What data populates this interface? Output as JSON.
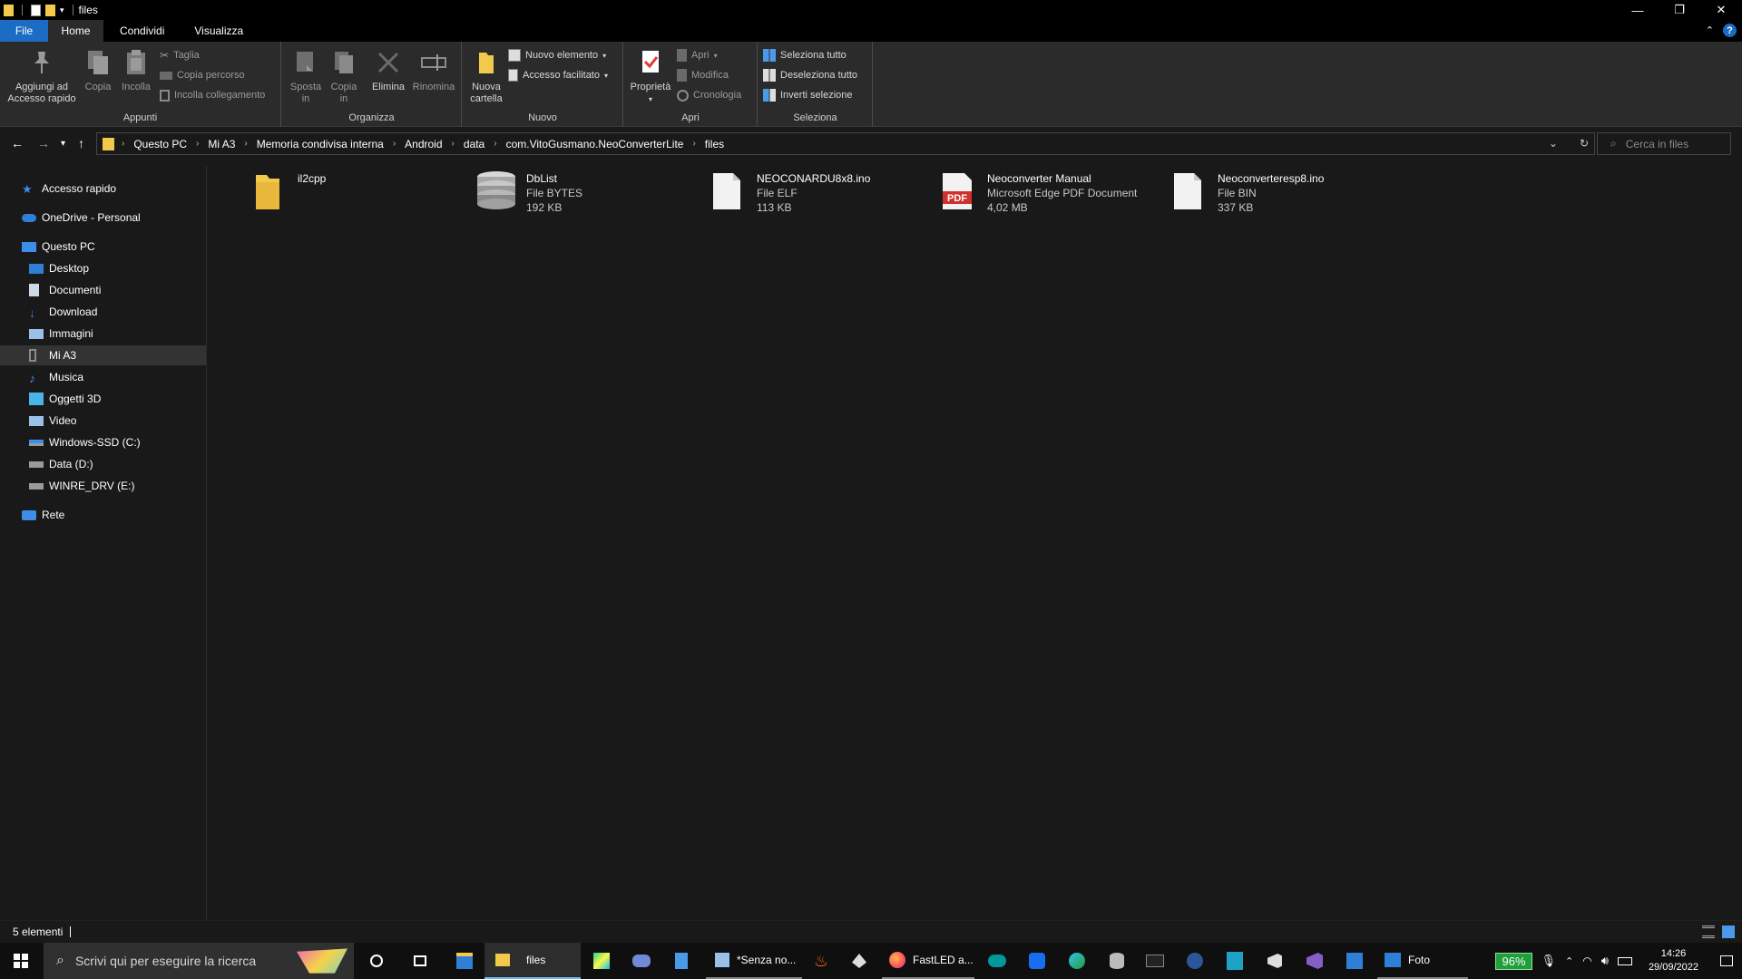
{
  "window": {
    "title": "files",
    "controls": {
      "minimize": "—",
      "maximize": "❐",
      "close": "✕"
    }
  },
  "ribbon_tabs": [
    {
      "label": "File"
    },
    {
      "label": "Home"
    },
    {
      "label": "Condividi"
    },
    {
      "label": "Visualizza"
    }
  ],
  "ribbon": {
    "appunti": {
      "label": "Appunti",
      "pin": "Aggiungi ad Accesso rapido",
      "copy": "Copia",
      "paste": "Incolla",
      "cut": "Taglia",
      "copy_path": "Copia percorso",
      "paste_link": "Incolla collegamento"
    },
    "organizza": {
      "label": "Organizza",
      "move": "Sposta in",
      "copyto": "Copia in",
      "delete": "Elimina",
      "rename": "Rinomina"
    },
    "nuovo": {
      "label": "Nuovo",
      "new_folder": "Nuova cartella",
      "new_item": "Nuovo elemento",
      "easy_access": "Accesso facilitato"
    },
    "apri": {
      "label": "Apri",
      "properties": "Proprietà",
      "open": "Apri",
      "edit": "Modifica",
      "history": "Cronologia"
    },
    "seleziona": {
      "label": "Seleziona",
      "select_all": "Seleziona tutto",
      "select_none": "Deseleziona tutto",
      "invert": "Inverti selezione"
    }
  },
  "address": {
    "crumbs": [
      "Questo PC",
      "Mi A3",
      "Memoria condivisa interna",
      "Android",
      "data",
      "com.VitoGusmano.NeoConverterLite",
      "files"
    ],
    "search_placeholder": "Cerca in files"
  },
  "sidebar": [
    {
      "label": "Accesso rapido",
      "icon": "star-icon",
      "color": "#3d8ee8"
    },
    {
      "label": "OneDrive - Personal",
      "icon": "cloud-icon",
      "color": "#2f7fd6"
    },
    {
      "label": "Questo PC",
      "icon": "computer-icon",
      "color": "#3d8ee8"
    },
    {
      "label": "Desktop",
      "icon": "desktop-icon",
      "color": "#2f7fd6"
    },
    {
      "label": "Documenti",
      "icon": "document-icon",
      "color": "#cfd8e6"
    },
    {
      "label": "Download",
      "icon": "download-icon",
      "color": "#2f7fd6"
    },
    {
      "label": "Immagini",
      "icon": "pictures-icon",
      "color": "#9ac0e8"
    },
    {
      "label": "Mi A3",
      "icon": "phone-icon",
      "color": "#8a8a8a"
    },
    {
      "label": "Musica",
      "icon": "music-icon",
      "color": "#3d8ee8"
    },
    {
      "label": "Oggetti 3D",
      "icon": "cube-icon",
      "color": "#4ab3e8"
    },
    {
      "label": "Video",
      "icon": "video-icon",
      "color": "#9ac0e8"
    },
    {
      "label": "Windows-SSD (C:)",
      "icon": "drive-windows-icon",
      "color": "#9a9a9a"
    },
    {
      "label": "Data (D:)",
      "icon": "drive-icon",
      "color": "#9a9a9a"
    },
    {
      "label": "WINRE_DRV (E:)",
      "icon": "drive-icon",
      "color": "#9a9a9a"
    },
    {
      "label": "Rete",
      "icon": "network-icon",
      "color": "#3d8ee8"
    }
  ],
  "files": [
    {
      "name": "il2cpp",
      "type": "",
      "size": "",
      "icon": "folder-icon"
    },
    {
      "name": "DbList",
      "type": "File BYTES",
      "size": "192 KB",
      "icon": "database-icon"
    },
    {
      "name": "NEOCONARDU8x8.ino",
      "type": "File ELF",
      "size": "113 KB",
      "icon": "file-icon"
    },
    {
      "name": "Neoconverter Manual",
      "type": "Microsoft Edge PDF Document",
      "size": "4,02 MB",
      "icon": "pdf-icon"
    },
    {
      "name": "Neoconverteresp8.ino",
      "type": "File BIN",
      "size": "337 KB",
      "icon": "file-icon"
    }
  ],
  "status": {
    "count": "5 elementi"
  },
  "taskbar": {
    "search_placeholder": "Scrivi qui per eseguire la ricerca",
    "apps": [
      {
        "label": "files",
        "icon": "folder-icon"
      },
      {
        "label": "*Senza no...",
        "icon": "notepad-icon"
      },
      {
        "label": "FastLED a...",
        "icon": "firefox-icon"
      },
      {
        "label": "Foto",
        "icon": "photos-icon"
      }
    ],
    "battery": "96%",
    "time": "14:26",
    "date": "29/09/2022"
  },
  "colors": {
    "accent": "#1a6cc4",
    "folder": "#f3c94c",
    "pdf_red": "#d0312d",
    "battery_green": "#1f9e3a"
  }
}
